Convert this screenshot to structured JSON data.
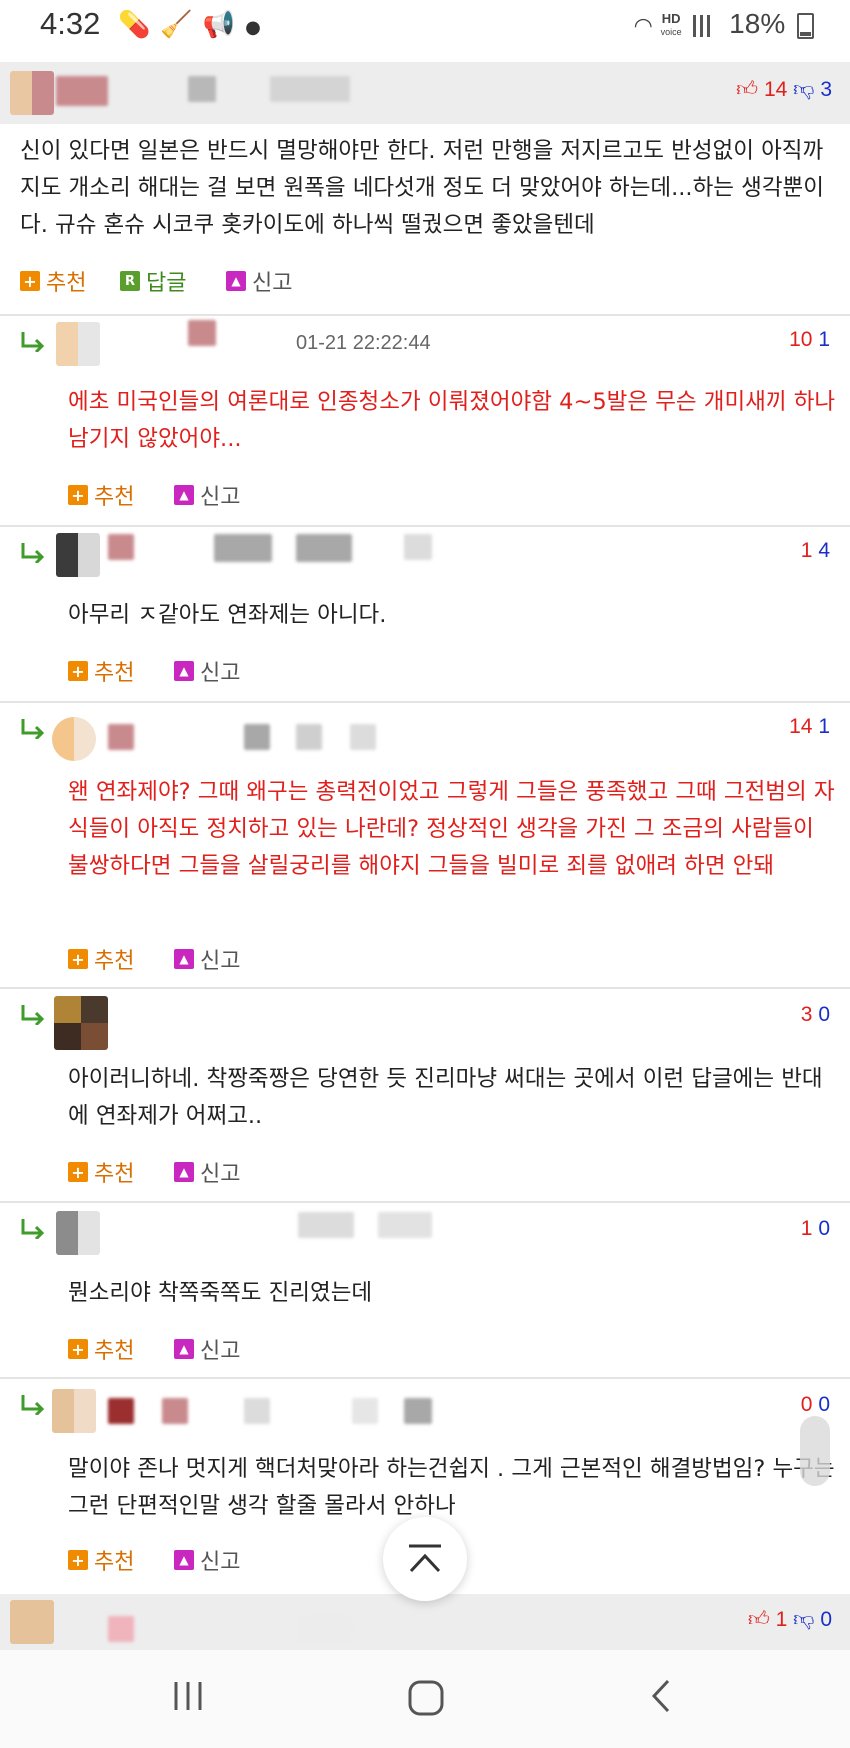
{
  "status_bar": {
    "time": "4:32",
    "icons": [
      "pill-icon",
      "broom-icon",
      "megaphone-icon",
      "dot-icon"
    ],
    "network_label_top": "HD",
    "network_label_bottom": "voice",
    "battery": "18%"
  },
  "top_comment": {
    "upvotes": "14",
    "downvotes": "3",
    "text": "신이 있다면 일본은 반드시 멸망해야만 한다. 저런 만행을 저지르고도 반성없이 아직까지도 개소리 해대는 걸 보면 원폭을 네다섯개 정도 더 맞았어야 하는데...하는 생각뿐이다. 규슈 혼슈 시코쿠 홋카이도에 하나씩 떨궜으면 좋았을텐데",
    "recommend_label": "추천",
    "reply_label": "답글",
    "report_label": "신고"
  },
  "replies": [
    {
      "date": "01-21 22:22:44",
      "up": "10",
      "down": "1",
      "text": "에초 미국인들의 여론대로 인종청소가 이뤄졌어야함 4~5발은 무슨 개미새끼 하나 남기지 않았어야...",
      "recommend_label": "추천",
      "report_label": "신고"
    },
    {
      "up": "1",
      "down": "4",
      "text": "아무리 ㅈ같아도 연좌제는 아니다.",
      "recommend_label": "추천",
      "report_label": "신고"
    },
    {
      "up": "14",
      "down": "1",
      "text": "왠 연좌제야? 그때 왜구는 총력전이었고 그렇게 그들은 풍족했고 그때 그전범의 자식들이 아직도 정치하고 있는 나란데? 정상적인 생각을 가진 그 조금의 사람들이 불쌍하다면 그들을 살릴궁리를 해야지 그들을 빌미로 죄를 없애려 하면 안돼",
      "recommend_label": "추천",
      "report_label": "신고"
    },
    {
      "up": "3",
      "down": "0",
      "text": "아이러니하네. 착짱죽짱은 당연한 듯 진리마냥 써대는 곳에서 이런 답글에는 반대에 연좌제가 어쩌고..",
      "recommend_label": "추천",
      "report_label": "신고"
    },
    {
      "up": "1",
      "down": "0",
      "text": "뭔소리야 착쪽죽쪽도 진리였는데",
      "recommend_label": "추천",
      "report_label": "신고"
    },
    {
      "up": "0",
      "down": "0",
      "text": "말이야 존나 멋지게 핵더처맞아라 하는건쉽지 . 그게 근본적인 해결방법임? 누구는 그런 단편적인말 생각 할줄 몰라서 안하나",
      "recommend_label": "추천",
      "report_label": "신고"
    }
  ],
  "next_comment": {
    "upvotes": "1",
    "downvotes": "0"
  },
  "colors": {
    "red_text": "#e0201c",
    "blue_text": "#1a2fc9",
    "recommend_orange": "#f08a00",
    "reply_green": "#5a9e2e",
    "report_magenta": "#c928c0",
    "header_gray": "#ededed"
  }
}
